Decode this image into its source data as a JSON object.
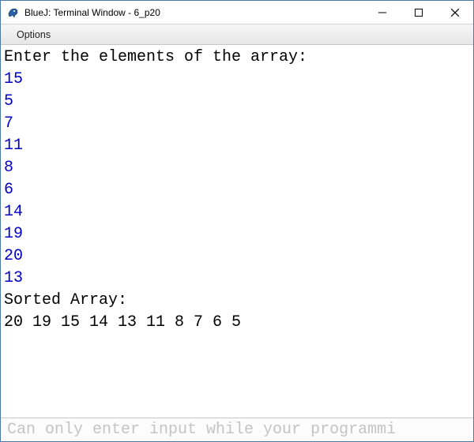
{
  "titlebar": {
    "title": "BlueJ: Terminal Window - 6_p20"
  },
  "menubar": {
    "options_label": "Options"
  },
  "terminal": {
    "prompt1": "Enter the elements of the array:",
    "inputs": [
      "15",
      "5",
      "7",
      "11",
      "8",
      "6",
      "14",
      "19",
      "20",
      "13"
    ],
    "prompt2": "Sorted Array:",
    "sorted_line": "20 19 15 14 13 11 8 7 6 5"
  },
  "inputbar": {
    "placeholder": "Can only enter input while your programmi"
  }
}
